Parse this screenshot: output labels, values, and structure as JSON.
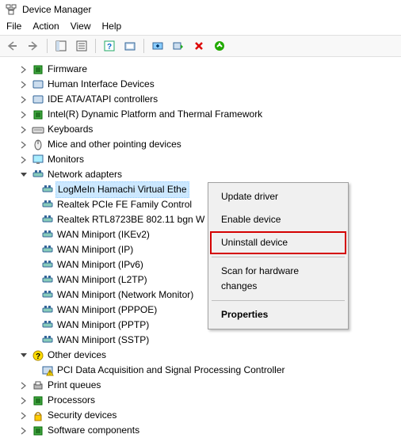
{
  "window": {
    "title": "Device Manager"
  },
  "menu": {
    "file": "File",
    "action": "Action",
    "view": "View",
    "help": "Help"
  },
  "tree": {
    "firmware": "Firmware",
    "hid": "Human Interface Devices",
    "ide": "IDE ATA/ATAPI controllers",
    "intel": "Intel(R) Dynamic Platform and Thermal Framework",
    "keyboards": "Keyboards",
    "mice": "Mice and other pointing devices",
    "monitors": "Monitors",
    "network": "Network adapters",
    "net_items": [
      "LogMeIn Hamachi Virtual Ethe",
      "Realtek PCIe FE Family Control",
      "Realtek RTL8723BE 802.11 bgn W",
      "WAN Miniport (IKEv2)",
      "WAN Miniport (IP)",
      "WAN Miniport (IPv6)",
      "WAN Miniport (L2TP)",
      "WAN Miniport (Network Monitor)",
      "WAN Miniport (PPPOE)",
      "WAN Miniport (PPTP)",
      "WAN Miniport (SSTP)"
    ],
    "other": "Other devices",
    "other_item": "PCI Data Acquisition and Signal Processing Controller",
    "print": "Print queues",
    "processors": "Processors",
    "security": "Security devices",
    "software": "Software components"
  },
  "context": {
    "update": "Update driver",
    "enable": "Enable device",
    "uninstall": "Uninstall device",
    "scan": "Scan for hardware changes",
    "properties": "Properties"
  }
}
